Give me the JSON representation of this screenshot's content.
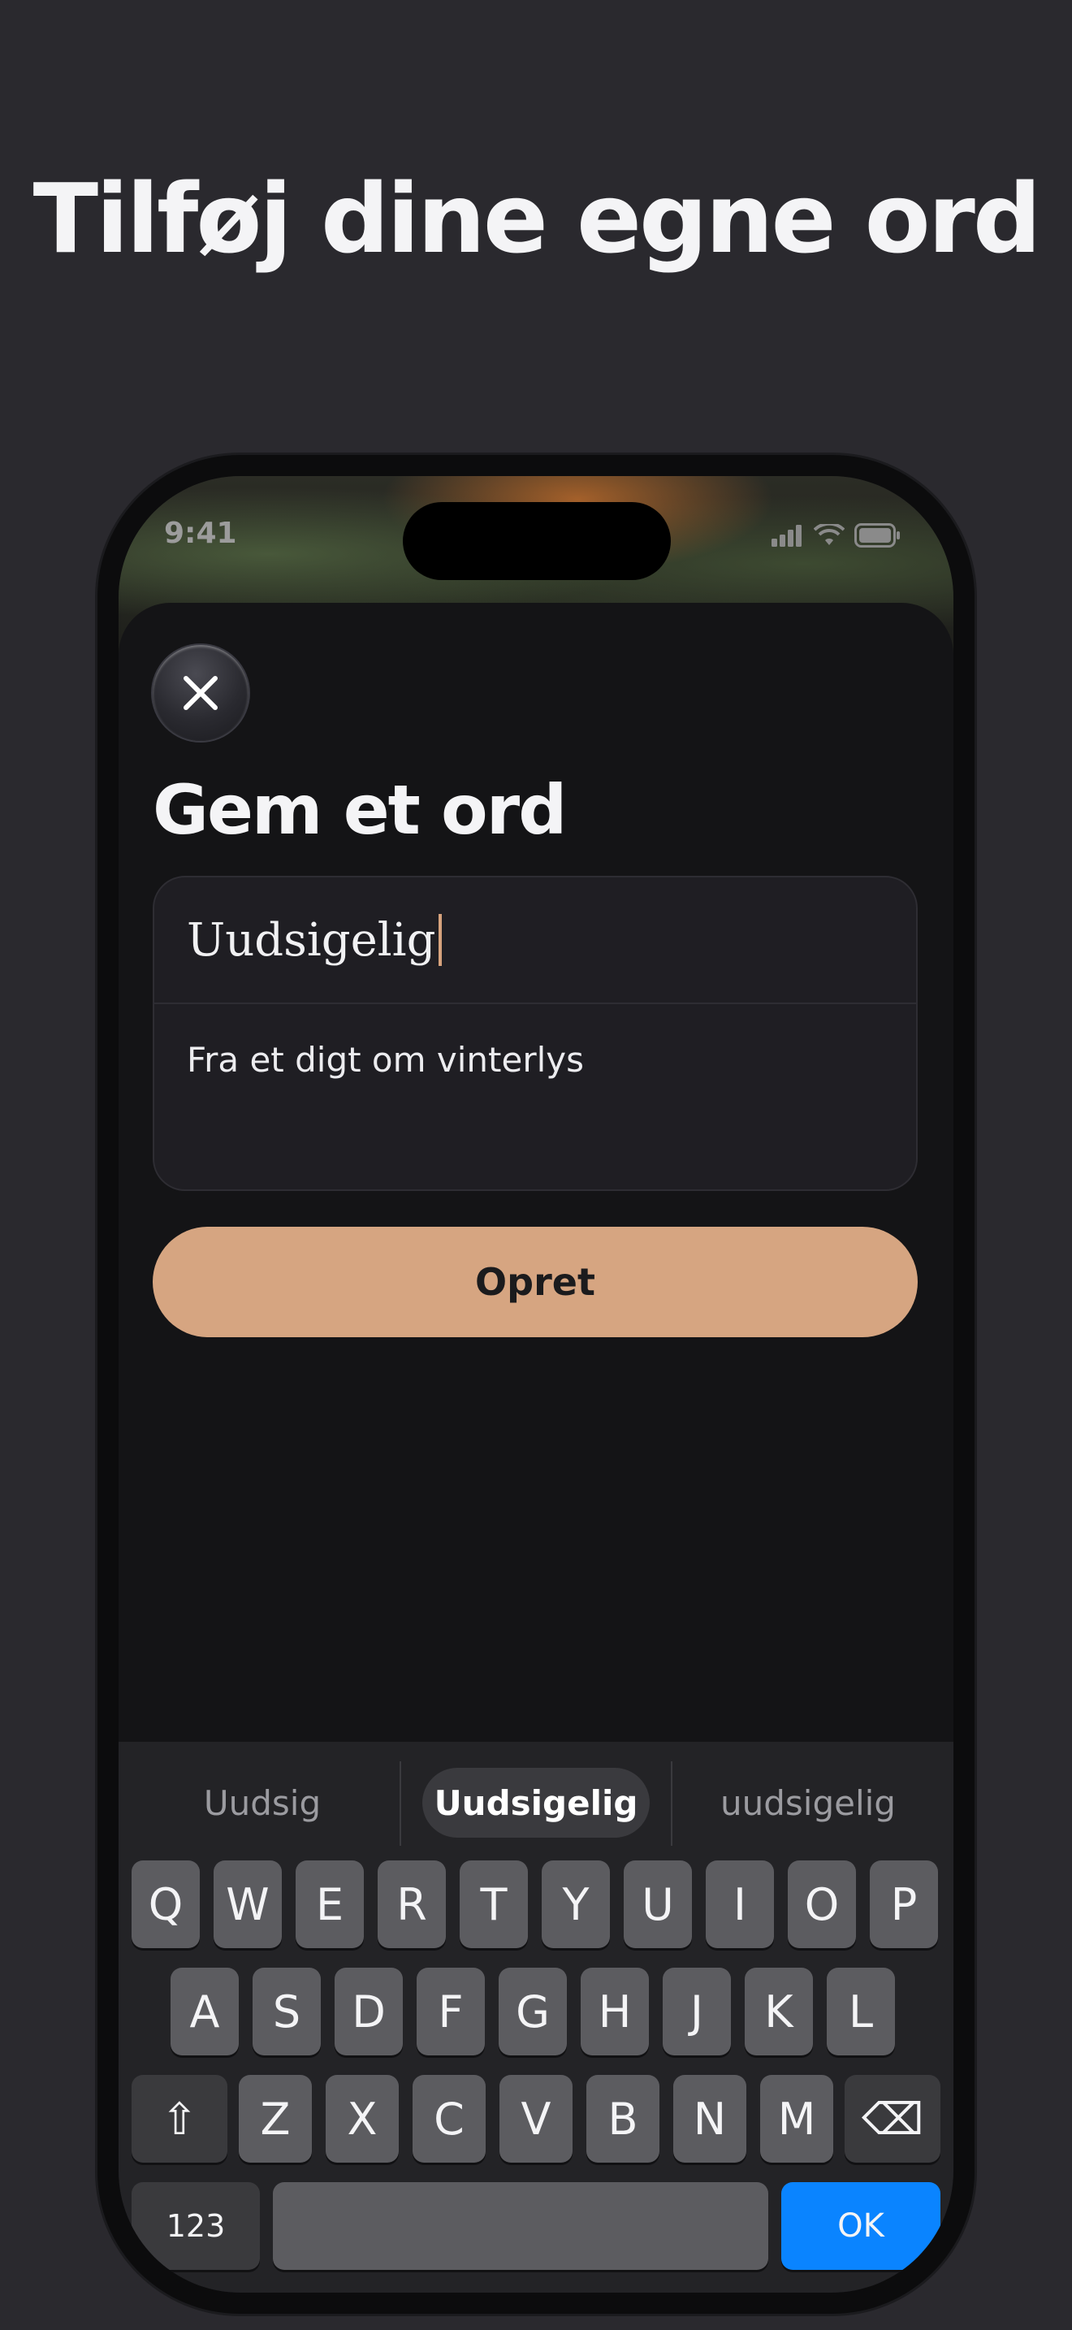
{
  "headline": "Tilføj dine egne ord",
  "status_bar": {
    "time": "9:41"
  },
  "sheet": {
    "title": "Gem et ord",
    "word_input": {
      "value": "Uudsigelig"
    },
    "note_input": {
      "value": "Fra et digt om vinterlys"
    },
    "create_button": "Opret"
  },
  "keyboard": {
    "suggestions": [
      "Uudsig",
      "Uudsigelig",
      "uudsigelig"
    ],
    "row1": [
      "Q",
      "W",
      "E",
      "R",
      "T",
      "Y",
      "U",
      "I",
      "O",
      "P"
    ],
    "row2": [
      "A",
      "S",
      "D",
      "F",
      "G",
      "H",
      "J",
      "K",
      "L"
    ],
    "row3": [
      "Z",
      "X",
      "C",
      "V",
      "B",
      "N",
      "M"
    ],
    "shift": "⇧",
    "backspace": "⌫",
    "numbers": "123",
    "ok": "OK"
  },
  "colors": {
    "background": "#2a292e",
    "accent_button": "#d6a581",
    "ok_key": "#0a84ff",
    "caret": "#d7a37d"
  }
}
